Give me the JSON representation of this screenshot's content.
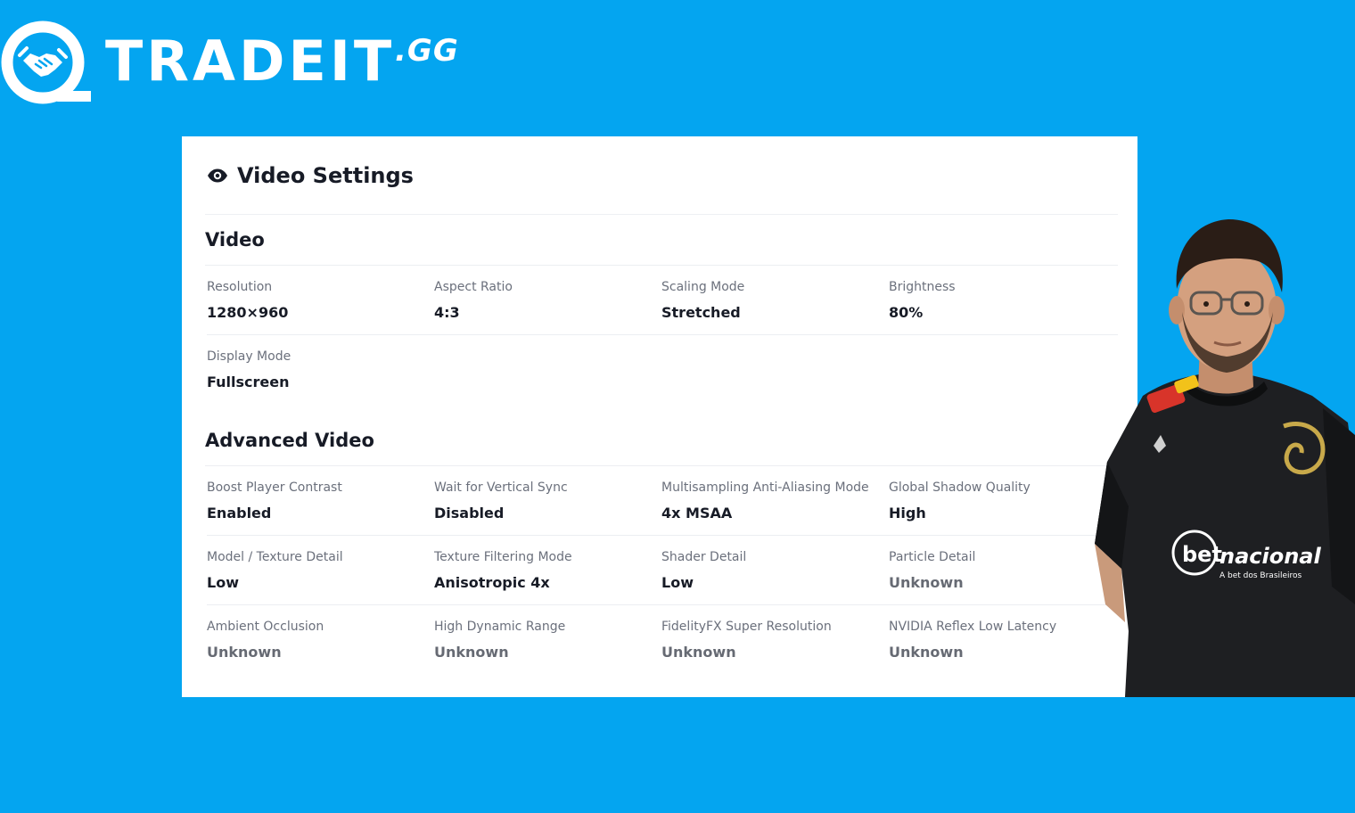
{
  "brand": {
    "name": "TRADEIT",
    "tld": ".GG",
    "logo_icon": "handshake-icon",
    "background_color": "#04a5f0"
  },
  "card": {
    "title": "Video Settings",
    "title_icon": "eye-icon"
  },
  "sections": {
    "video": {
      "title": "Video",
      "rows": [
        [
          {
            "label": "Resolution",
            "value": "1280×960"
          },
          {
            "label": "Aspect Ratio",
            "value": "4:3"
          },
          {
            "label": "Scaling Mode",
            "value": "Stretched"
          },
          {
            "label": "Brightness",
            "value": "80%"
          }
        ],
        [
          {
            "label": "Display Mode",
            "value": "Fullscreen"
          }
        ]
      ]
    },
    "advanced": {
      "title": "Advanced Video",
      "rows": [
        [
          {
            "label": "Boost Player Contrast",
            "value": "Enabled"
          },
          {
            "label": "Wait for Vertical Sync",
            "value": "Disabled"
          },
          {
            "label": "Multisampling Anti-Aliasing Mode",
            "value": "4x MSAA"
          },
          {
            "label": "Global Shadow Quality",
            "value": "High"
          }
        ],
        [
          {
            "label": "Model / Texture Detail",
            "value": "Low"
          },
          {
            "label": "Texture Filtering Mode",
            "value": "Anisotropic 4x"
          },
          {
            "label": "Shader Detail",
            "value": "Low"
          },
          {
            "label": "Particle Detail",
            "value": "Unknown"
          }
        ],
        [
          {
            "label": "Ambient Occlusion",
            "value": "Unknown"
          },
          {
            "label": "High Dynamic Range",
            "value": "Unknown"
          },
          {
            "label": "FidelityFX Super Resolution",
            "value": "Unknown"
          },
          {
            "label": "NVIDIA Reflex Low Latency",
            "value": "Unknown"
          }
        ]
      ]
    }
  },
  "player": {
    "jersey_sponsor": "bet",
    "jersey_sponsor_suffix": "nacional",
    "jersey_sponsor_tagline": "A bet dos Brasileiros"
  }
}
